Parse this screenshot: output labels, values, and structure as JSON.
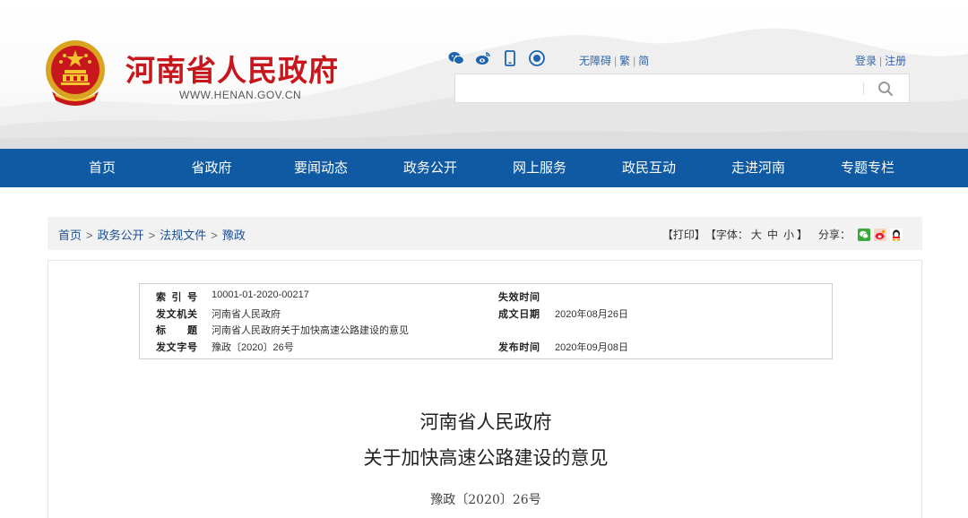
{
  "header": {
    "title": "河南省人民政府",
    "url": "WWW.HENAN.GOV.CN",
    "social_icons": [
      "wechat-icon",
      "weibo-icon",
      "mobile-icon",
      "app-icon"
    ],
    "access_links": [
      "无障碍",
      "繁",
      "简"
    ],
    "user_links": [
      "登录",
      "注册"
    ],
    "search": {
      "placeholder": "",
      "value": ""
    }
  },
  "nav": {
    "items": [
      "首页",
      "省政府",
      "要闻动态",
      "政务公开",
      "网上服务",
      "政民互动",
      "走进河南",
      "专题专栏"
    ]
  },
  "breadcrumb": [
    "首页",
    "政务公开",
    "法规文件",
    "豫政"
  ],
  "tools": {
    "print": "【打印】",
    "font_prefix": "【字体：",
    "font_sizes": [
      "大",
      "中",
      "小"
    ],
    "font_suffix": "】",
    "share_label": "分享："
  },
  "meta": {
    "index_label": "索 引 号",
    "index_value": "10001-01-2020-00217",
    "expiry_label": "失效时间",
    "expiry_value": "",
    "issuer_label": "发文机关",
    "issuer_value": "河南省人民政府",
    "written_label": "成文日期",
    "written_value": "2020年08月26日",
    "title_label": "标 题",
    "title_value": "河南省人民政府关于加快高速公路建设的意见",
    "docno_label": "发文字号",
    "docno_value": "豫政〔2020〕26号",
    "published_label": "发布时间",
    "published_value": "2020年09月08日"
  },
  "document": {
    "title_line1": "河南省人民政府",
    "title_line2": "关于加快高速公路建设的意见",
    "number": "豫政〔2020〕26号"
  },
  "colors": {
    "brand_red": "#c8161d",
    "nav_blue": "#0f5aa3",
    "link_blue": "#1a4f95"
  }
}
